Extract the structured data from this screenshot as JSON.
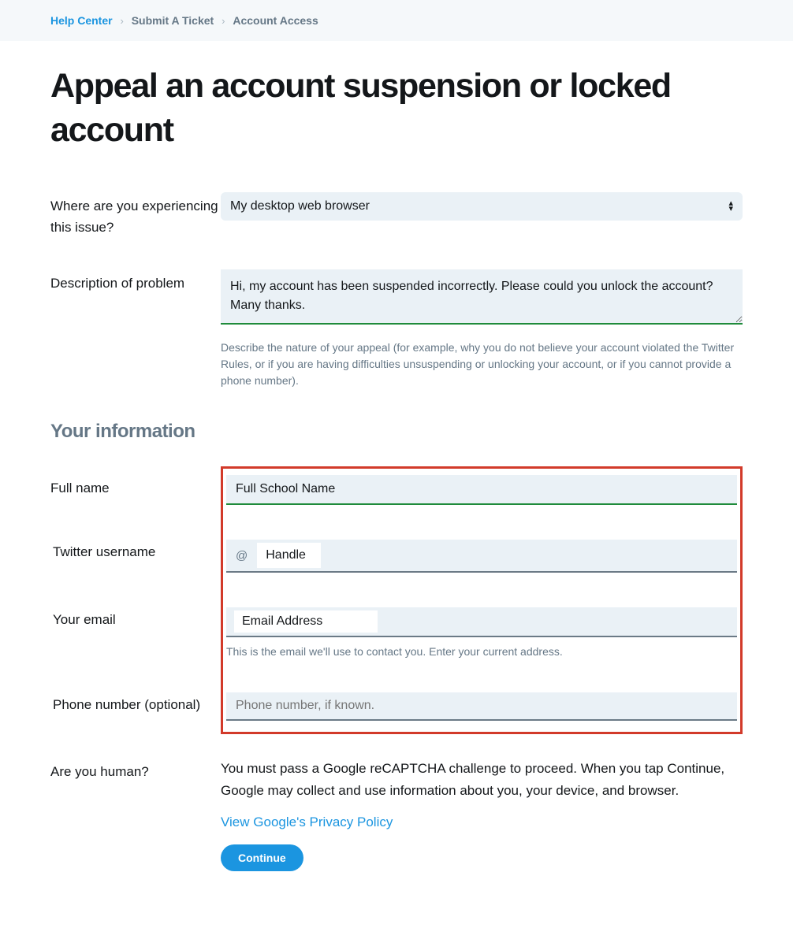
{
  "breadcrumb": {
    "items": [
      "Help Center",
      "Submit A Ticket",
      "Account Access"
    ]
  },
  "page_title": "Appeal an account suspension or locked account",
  "issue_location": {
    "label": "Where are you experiencing this issue?",
    "selected": "My desktop web browser"
  },
  "description": {
    "label": "Description of problem",
    "value": "Hi, my account has been suspended incorrectly. Please could you unlock the account? Many thanks.",
    "help": "Describe the nature of your appeal (for example, why you do not believe your account violated the Twitter Rules, or if you are having difficulties unsuspending or unlocking your account, or if you cannot provide a phone number)."
  },
  "your_info_heading": "Your information",
  "full_name": {
    "label": "Full name",
    "value": "Full School Name"
  },
  "username": {
    "label": "Twitter username",
    "prefix": "@",
    "value": "Handle"
  },
  "email": {
    "label": "Your email",
    "value": "Email Address",
    "help": "This is the email we'll use to contact you. Enter your current address."
  },
  "phone": {
    "label": "Phone number ",
    "optional": "(optional)",
    "placeholder": "Phone number, if known."
  },
  "captcha": {
    "label": "Are you human?",
    "text": "You must pass a Google reCAPTCHA challenge to proceed. When you tap Continue, Google may collect and use information about you, your device, and browser.",
    "policy_link": "View Google's Privacy Policy",
    "button": "Continue"
  }
}
